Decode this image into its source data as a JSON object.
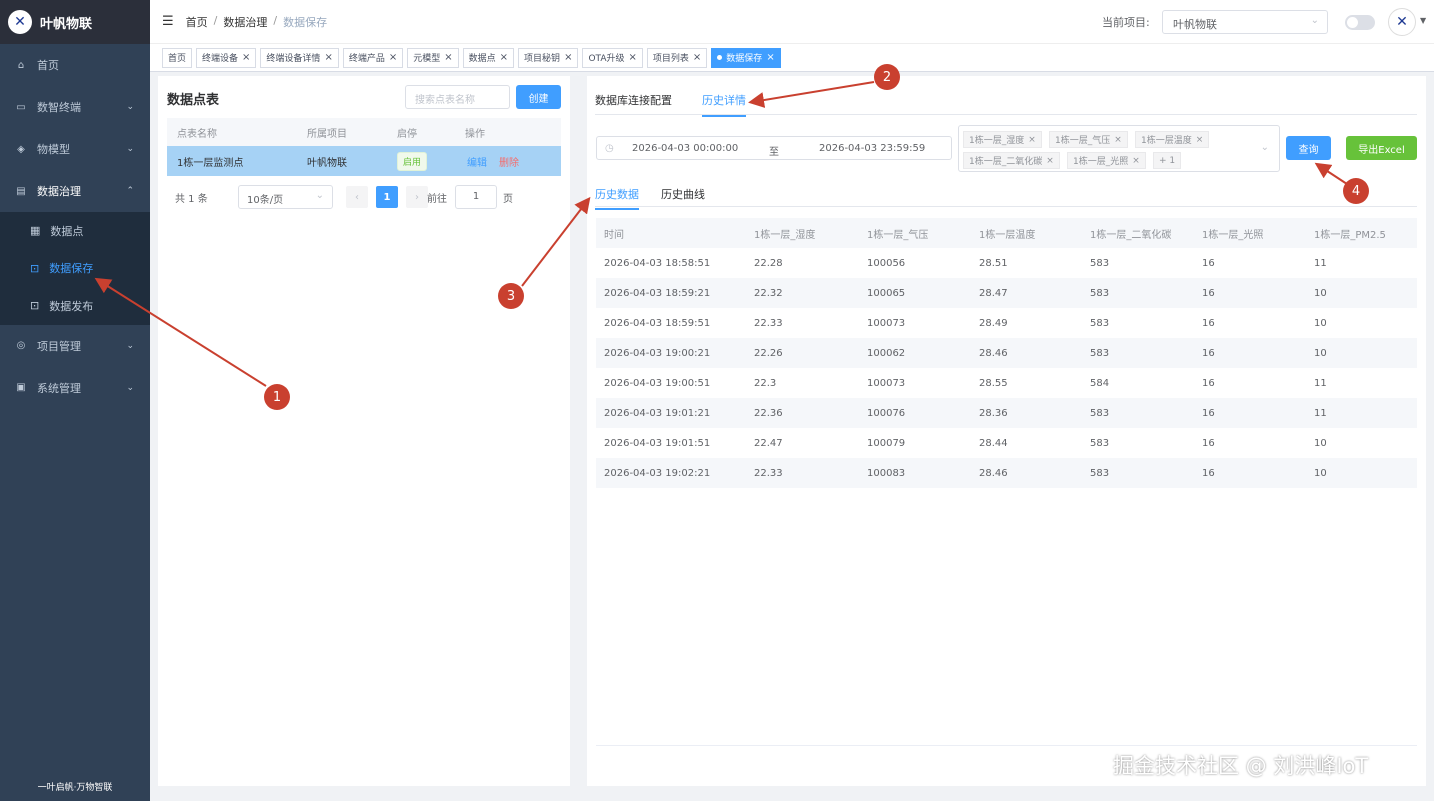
{
  "brand": {
    "logo_glyph": "✕",
    "title": "叶帆物联"
  },
  "sidebar": {
    "items": [
      {
        "label": "首页",
        "icon": "home-icon"
      },
      {
        "label": "数智终端",
        "icon": "monitor-icon"
      },
      {
        "label": "物模型",
        "icon": "cube-icon"
      },
      {
        "label": "数据治理",
        "icon": "document-icon"
      }
    ],
    "subitems": [
      {
        "label": "数据点",
        "icon": "table-icon"
      },
      {
        "label": "数据保存",
        "icon": "save-icon"
      },
      {
        "label": "数据发布",
        "icon": "publish-icon"
      }
    ],
    "items_after": [
      {
        "label": "项目管理",
        "icon": "project-icon"
      },
      {
        "label": "系统管理",
        "icon": "system-icon"
      }
    ],
    "footer": "一叶启帆·万物智联"
  },
  "header": {
    "breadcrumb": [
      "首页",
      "数据治理",
      "数据保存"
    ],
    "project_label": "当前项目:",
    "project_value": "叶帆物联"
  },
  "tags": [
    {
      "label": "首页"
    },
    {
      "label": "终端设备"
    },
    {
      "label": "终端设备详情"
    },
    {
      "label": "终端产品"
    },
    {
      "label": "元模型"
    },
    {
      "label": "数据点"
    },
    {
      "label": "项目秘钥"
    },
    {
      "label": "OTA升级"
    },
    {
      "label": "项目列表"
    },
    {
      "label": "数据保存"
    }
  ],
  "left": {
    "title": "数据点表",
    "search_placeholder": "搜索点表名称",
    "create_label": "创建",
    "columns": [
      "点表名称",
      "所属项目",
      "启停",
      "操作"
    ],
    "row": {
      "name": "1栋一层监测点",
      "project": "叶帆物联",
      "status": "启用",
      "edit": "编辑",
      "delete": "删除"
    },
    "pager": {
      "total": "共 1 条",
      "size": "10条/页",
      "page": "1",
      "goto": "前往",
      "goto_value": "1",
      "unit": "页"
    }
  },
  "right": {
    "tabs": [
      "数据库连接配置",
      "历史详情"
    ],
    "date_start": "2026-04-03 00:00:00",
    "date_to": "至",
    "date_end": "2026-04-03 23:59:59",
    "chips": [
      "1栋一层_湿度",
      "1栋一层_气压",
      "1栋一层温度",
      "1栋一层_二氧化碳",
      "1栋一层_光照",
      "+ 1"
    ],
    "query_label": "查询",
    "export_label": "导出Excel",
    "subtabs": [
      "历史数据",
      "历史曲线"
    ],
    "columns": [
      "时间",
      "1栋一层_湿度",
      "1栋一层_气压",
      "1栋一层温度",
      "1栋一层_二氧化碳",
      "1栋一层_光照",
      "1栋一层_PM2.5"
    ],
    "rows": [
      [
        "2026-04-03 18:58:51",
        "22.28",
        "100056",
        "28.51",
        "583",
        "16",
        "11"
      ],
      [
        "2026-04-03 18:59:21",
        "22.32",
        "100065",
        "28.47",
        "583",
        "16",
        "10"
      ],
      [
        "2026-04-03 18:59:51",
        "22.33",
        "100073",
        "28.49",
        "583",
        "16",
        "10"
      ],
      [
        "2026-04-03 19:00:21",
        "22.26",
        "100062",
        "28.46",
        "583",
        "16",
        "10"
      ],
      [
        "2026-04-03 19:00:51",
        "22.3",
        "100073",
        "28.55",
        "584",
        "16",
        "11"
      ],
      [
        "2026-04-03 19:01:21",
        "22.36",
        "100076",
        "28.36",
        "583",
        "16",
        "11"
      ],
      [
        "2026-04-03 19:01:51",
        "22.47",
        "100079",
        "28.44",
        "583",
        "16",
        "10"
      ],
      [
        "2026-04-03 19:02:21",
        "22.33",
        "100083",
        "28.46",
        "583",
        "16",
        "10"
      ]
    ]
  },
  "annotations": [
    "1",
    "2",
    "3",
    "4"
  ],
  "watermark": "掘金技术社区 @ 刘洪峰IoT",
  "colors": {
    "sidebar": "#304156",
    "accent": "#409eff",
    "success": "#67c23a",
    "danger": "#f56c6c",
    "annotation": "#c9402f"
  }
}
